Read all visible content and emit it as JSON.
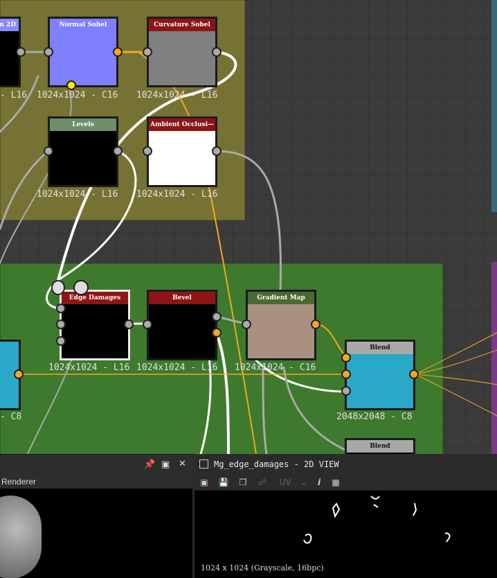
{
  "graph": {
    "nodes": [
      {
        "id": "n2d",
        "title": "n 2D",
        "resolution": "- L16",
        "title_color": "#8a8aff",
        "body": "#000000"
      },
      {
        "id": "normal_sobel",
        "title": "Normal Sobel",
        "resolution": "1024x1024 - C16",
        "title_color": "#8080ff",
        "body": "#8080ff"
      },
      {
        "id": "curvature_sobel",
        "title": "Curvature Sobel",
        "resolution": "1024x1024 - L16",
        "title_color": "#8f1414",
        "body": "#808080"
      },
      {
        "id": "levels",
        "title": "Levels",
        "resolution": "1024x1024 - L16",
        "title_color": "#6f8f6a",
        "body": "#000000"
      },
      {
        "id": "ambient_occlusion",
        "title": "Ambient Occlusi—",
        "resolution": "1024x1024 - L16",
        "title_color": "#8f1414",
        "body": "#ffffff"
      },
      {
        "id": "edge_damages",
        "title": "Edge Damages",
        "resolution": "1024x1024 - L16",
        "title_color": "#8f1414",
        "body": "#000000"
      },
      {
        "id": "bevel",
        "title": "Bevel",
        "resolution": "1024x1024 - L16",
        "title_color": "#8f1414",
        "body": "#000000"
      },
      {
        "id": "gradient_map",
        "title": "Gradient Map",
        "resolution": "1024x1024 - C16",
        "title_color": "#4a6a30",
        "body": "#a99080"
      },
      {
        "id": "blend1",
        "title": "Blend",
        "resolution": "2048x2048 - C8",
        "title_color": "#a8a8a8",
        "body": "#2aa8c8"
      },
      {
        "id": "blend2",
        "title": "Blend",
        "resolution": "",
        "title_color": "#a8a8a8",
        "body": "#000000"
      },
      {
        "id": "left_c8",
        "title": "",
        "resolution": "- C8",
        "title_color": "#2aa8c8",
        "body": "#2aa8c8"
      }
    ]
  },
  "dock": {
    "left_panel_title": "Renderer",
    "right_panel_title": "Mg_edge_damages - 2D VIEW",
    "uv_label": "UV",
    "info_label": "i",
    "image_info": "1024 x 1024 (Grayscale, 16bpc)"
  },
  "icons": {
    "pin": "pin-icon",
    "maximize": "maximize-icon",
    "close": "close-icon"
  }
}
